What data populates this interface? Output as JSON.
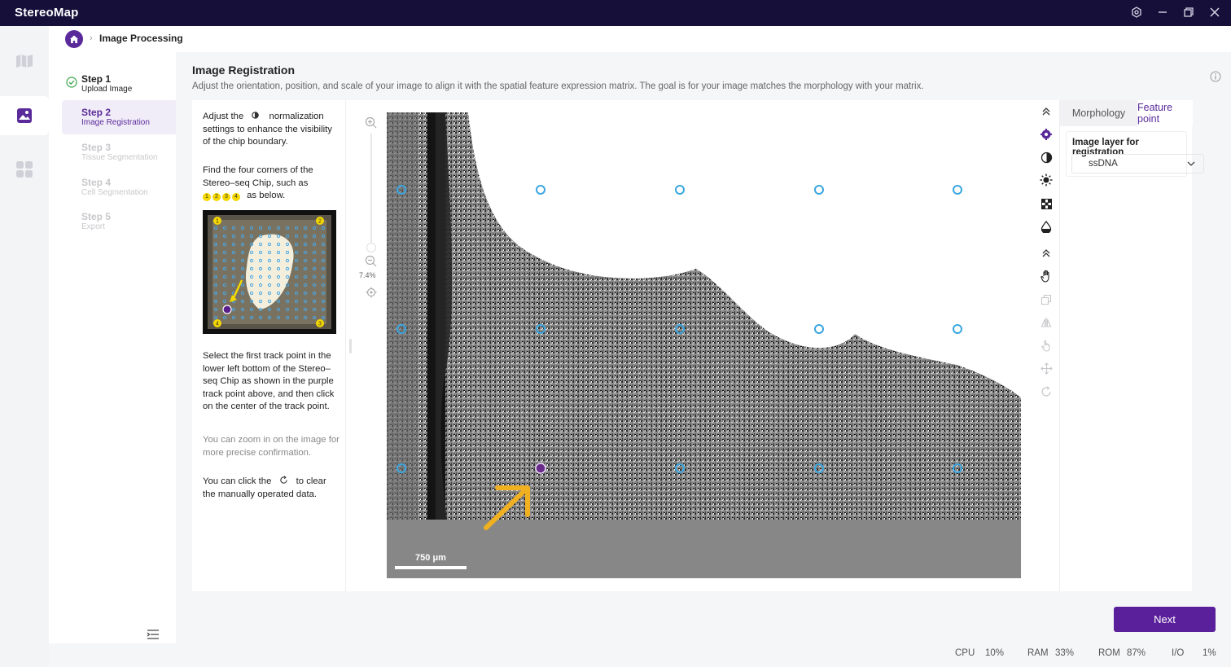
{
  "app": {
    "title": "StereoMap"
  },
  "breadcrumb": {
    "current": "Image Processing"
  },
  "steps": [
    {
      "title": "Step 1",
      "subtitle": "Upload Image",
      "state": "done"
    },
    {
      "title": "Step 2",
      "subtitle": "Image Registration",
      "state": "active"
    },
    {
      "title": "Step 3",
      "subtitle": "Tissue Segmentation",
      "state": "pending"
    },
    {
      "title": "Step 4",
      "subtitle": "Cell Segmentation",
      "state": "pending"
    },
    {
      "title": "Step 5",
      "subtitle": "Export",
      "state": "pending"
    }
  ],
  "page": {
    "title": "Image Registration",
    "description": "Adjust the orientation, position, and scale of your image to align it with the spatial feature expression matrix. The goal is for your image matches the morphology with your matrix."
  },
  "instructions": {
    "p1_before": "Adjust the",
    "p1_after": "normalization settings to enhance the visibility of the chip boundary.",
    "p2": "Find the four corners of the Stereo–seq Chip, such as",
    "p2_chips": [
      "1",
      "2",
      "3",
      "4"
    ],
    "p2_after": "as below.",
    "p3": "Select the first track point in the lower left bottom of the Stereo–seq Chip as shown in the purple track point above, and then click on the center of the track point.",
    "p4": "You can zoom in on the image for more precise confirmation.",
    "p5_before": "You can click the",
    "p5_after": "to clear the manually operated data."
  },
  "thumbnail_markers": [
    "1",
    "2",
    "3",
    "4"
  ],
  "viewer": {
    "zoom": "7.4%",
    "scale_bar": "750 μm"
  },
  "right_panel": {
    "tabs": [
      "Morphology",
      "Feature point"
    ],
    "active_tab": "Feature point",
    "layer_title": "Image layer for registration",
    "layer_value": "ssDNA"
  },
  "actions": {
    "next": "Next"
  },
  "status_bar": {
    "cpu_label": "CPU",
    "cpu": "10%",
    "ram_label": "RAM",
    "ram": "33%",
    "rom_label": "ROM",
    "rom": "87%",
    "io_label": "I/O",
    "io": "1%"
  },
  "colors": {
    "accent": "#5a2a9a",
    "titlebar": "#160f3a",
    "track_point": "#3aa6e0",
    "selected_point": "#6a2a8a",
    "arrow": "#f0b020"
  }
}
